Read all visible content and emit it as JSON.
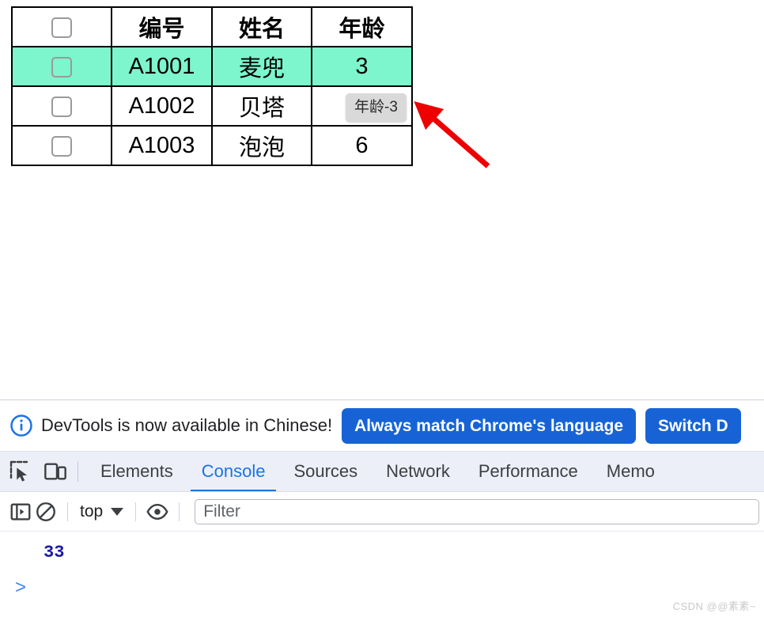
{
  "page": {
    "table": {
      "headers": [
        "",
        "编号",
        "姓名",
        "年龄"
      ],
      "header_checkbox_name": "select-all-checkbox",
      "rows": [
        {
          "id": "A1001",
          "name": "麦兜",
          "age": "3",
          "highlighted": true
        },
        {
          "id": "A1002",
          "name": "贝塔",
          "age": "",
          "highlighted": false
        },
        {
          "id": "A1003",
          "name": "泡泡",
          "age": "6",
          "highlighted": false
        }
      ],
      "highlight_color": "#7df5cd",
      "border_color": "#000000"
    },
    "tooltip": {
      "text": "年龄-3",
      "background": "#d9d9d9"
    },
    "annotation": {
      "arrow_color": "#ee0000"
    }
  },
  "devtools": {
    "banner": {
      "icon": "info-circle-icon",
      "message": "DevTools is now available in Chinese!",
      "primary_button": "Always match Chrome's language",
      "secondary_button": "Switch D",
      "button_color": "#1763d6"
    },
    "tabs": {
      "inspect_icon": "inspect-element-icon",
      "device_icon": "device-toolbar-icon",
      "items": [
        {
          "label": "Elements",
          "active": false
        },
        {
          "label": "Console",
          "active": true
        },
        {
          "label": "Sources",
          "active": false
        },
        {
          "label": "Network",
          "active": false
        },
        {
          "label": "Performance",
          "active": false
        },
        {
          "label": "Memo",
          "active": false
        }
      ],
      "active_color": "#1a73e8",
      "background": "#eceff7"
    },
    "console_toolbar": {
      "sidebar_icon": "console-sidebar-toggle-icon",
      "clear_icon": "clear-console-icon",
      "context": "top",
      "eye_icon": "live-expression-icon",
      "filter_placeholder": "Filter",
      "filter_value": ""
    },
    "console": {
      "result": "33",
      "prompt": ">"
    }
  },
  "watermark": {
    "text": "CSDN @@素素~"
  }
}
